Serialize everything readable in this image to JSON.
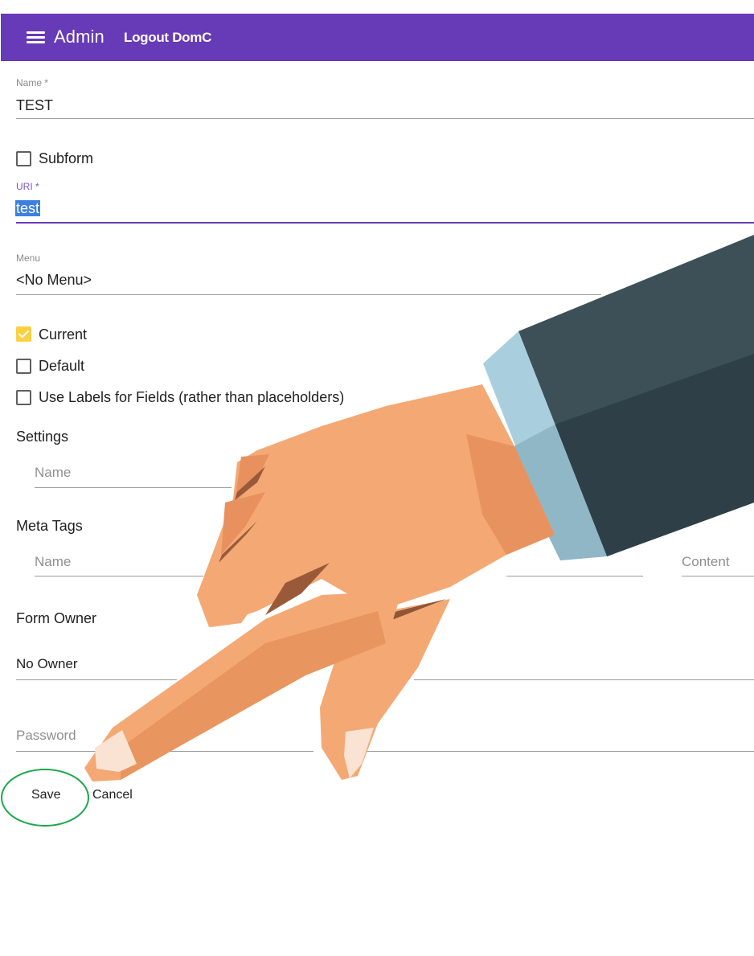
{
  "appbar": {
    "title": "Admin",
    "logout_label": "Logout DomC",
    "background": "#673ab7",
    "menu_icon": "hamburger-menu-icon"
  },
  "form": {
    "name": {
      "label": "Name *",
      "value": "TEST"
    },
    "subform": {
      "label": "Subform",
      "checked": false
    },
    "uri": {
      "label": "URI *",
      "value": "test"
    },
    "menu": {
      "label": "Menu",
      "value": "<No Menu>"
    },
    "current": {
      "label": "Current",
      "checked": true
    },
    "default": {
      "label": "Default",
      "checked": false
    },
    "use_labels": {
      "label": "Use Labels for Fields (rather than placeholders)",
      "checked": false
    },
    "settings": {
      "title": "Settings",
      "name_placeholder": "Name"
    },
    "meta_tags": {
      "title": "Meta Tags",
      "name_placeholder": "Name",
      "content_placeholder": "Content"
    },
    "form_owner": {
      "title": "Form Owner",
      "value": "No Owner"
    },
    "password": {
      "placeholder": "Password"
    }
  },
  "actions": {
    "save_label": "Save",
    "cancel_label": "Cancel"
  },
  "colors": {
    "accent": "#673ab7",
    "checkbox_checked": "#fbd041",
    "highlight_circle": "#19a84a",
    "selection": "#3d7fe0"
  }
}
